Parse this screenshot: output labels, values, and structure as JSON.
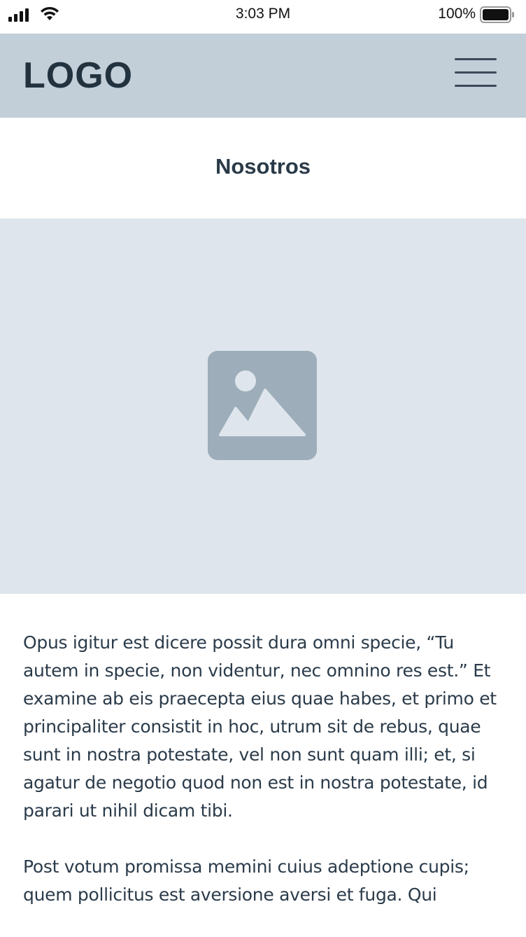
{
  "status_bar": {
    "time": "3:03 PM",
    "battery": "100%"
  },
  "header": {
    "logo": "LOGO",
    "menu_icon": "hamburger-menu-icon"
  },
  "page": {
    "title": "Nosotros",
    "hero_image_icon": "image-placeholder-icon",
    "paragraphs": [
      "Opus igitur est dicere possit dura omni specie, “Tu autem in specie, non videntur, nec omnino res est.” Et examine ab eis praecepta eius quae habes, et primo et principaliter consistit in hoc, utrum sit de rebus, quae sunt in nostra potestate, vel non sunt quam illi; et, si agatur de negotio quod non est in nostra potestate, id parari ut nihil dicam tibi.",
      "Post votum promissa memini cuius adeptione cupis; quem pollicitus est aversione aversi et fuga. Qui"
    ]
  },
  "colors": {
    "header_bg": "#c2ced8",
    "hero_bg": "#dfe5ec",
    "placeholder": "#9dadba",
    "text": "#2b3b4a"
  }
}
